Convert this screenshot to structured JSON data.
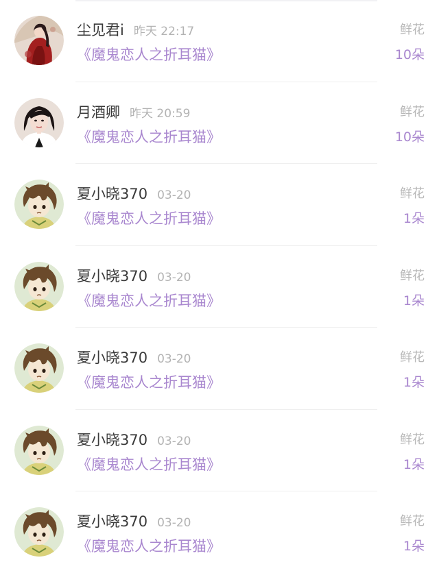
{
  "colors": {
    "accent": "#a987cf",
    "name": "#3a3a3a",
    "muted": "#b5b5b5"
  },
  "gifts": [
    {
      "avatar": "avatar-icon-red-costume",
      "name": "尘见君i",
      "time": "昨天 22:17",
      "book": "《魔鬼恋人之折耳猫》",
      "type": "鲜花",
      "amount": "10朵"
    },
    {
      "avatar": "avatar-icon-woman-portrait",
      "name": "月酒卿",
      "time": "昨天 20:59",
      "book": "《魔鬼恋人之折耳猫》",
      "type": "鲜花",
      "amount": "10朵"
    },
    {
      "avatar": "avatar-icon-anime-boy",
      "name": "夏小晓370",
      "time": "03-20",
      "book": "《魔鬼恋人之折耳猫》",
      "type": "鲜花",
      "amount": "1朵"
    },
    {
      "avatar": "avatar-icon-anime-boy",
      "name": "夏小晓370",
      "time": "03-20",
      "book": "《魔鬼恋人之折耳猫》",
      "type": "鲜花",
      "amount": "1朵"
    },
    {
      "avatar": "avatar-icon-anime-boy",
      "name": "夏小晓370",
      "time": "03-20",
      "book": "《魔鬼恋人之折耳猫》",
      "type": "鲜花",
      "amount": "1朵"
    },
    {
      "avatar": "avatar-icon-anime-boy",
      "name": "夏小晓370",
      "time": "03-20",
      "book": "《魔鬼恋人之折耳猫》",
      "type": "鲜花",
      "amount": "1朵"
    },
    {
      "avatar": "avatar-icon-anime-boy",
      "name": "夏小晓370",
      "time": "03-20",
      "book": "《魔鬼恋人之折耳猫》",
      "type": "鲜花",
      "amount": "1朵"
    }
  ]
}
